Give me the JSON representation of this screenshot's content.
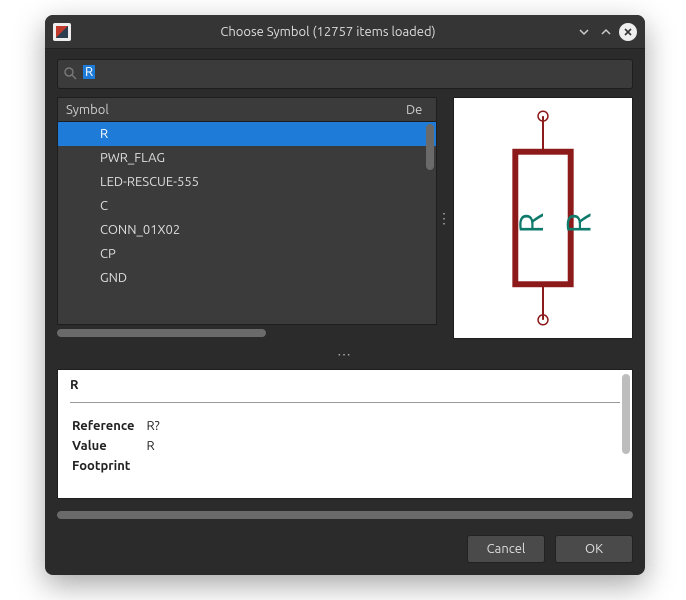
{
  "window": {
    "title": "Choose Symbol (12757 items loaded)"
  },
  "search": {
    "value": "R",
    "placeholder": ""
  },
  "tree": {
    "headers": {
      "symbol": "Symbol",
      "description": "De"
    },
    "items": [
      {
        "label": "R",
        "selected": true
      },
      {
        "label": "PWR_FLAG",
        "selected": false
      },
      {
        "label": "LED-RESCUE-555",
        "selected": false
      },
      {
        "label": "C",
        "selected": false
      },
      {
        "label": "CONN_01X02",
        "selected": false
      },
      {
        "label": "CP",
        "selected": false
      },
      {
        "label": "GND",
        "selected": false
      }
    ]
  },
  "preview": {
    "refdes": "R",
    "value": "R",
    "body_color": "#8c1a1a",
    "text_color": "#0e7a6b"
  },
  "details": {
    "title": "R",
    "rows": [
      {
        "key": "Reference",
        "value": "R?"
      },
      {
        "key": "Value",
        "value": "R"
      },
      {
        "key": "Footprint",
        "value": ""
      }
    ]
  },
  "footer": {
    "cancel": "Cancel",
    "ok": "OK"
  }
}
